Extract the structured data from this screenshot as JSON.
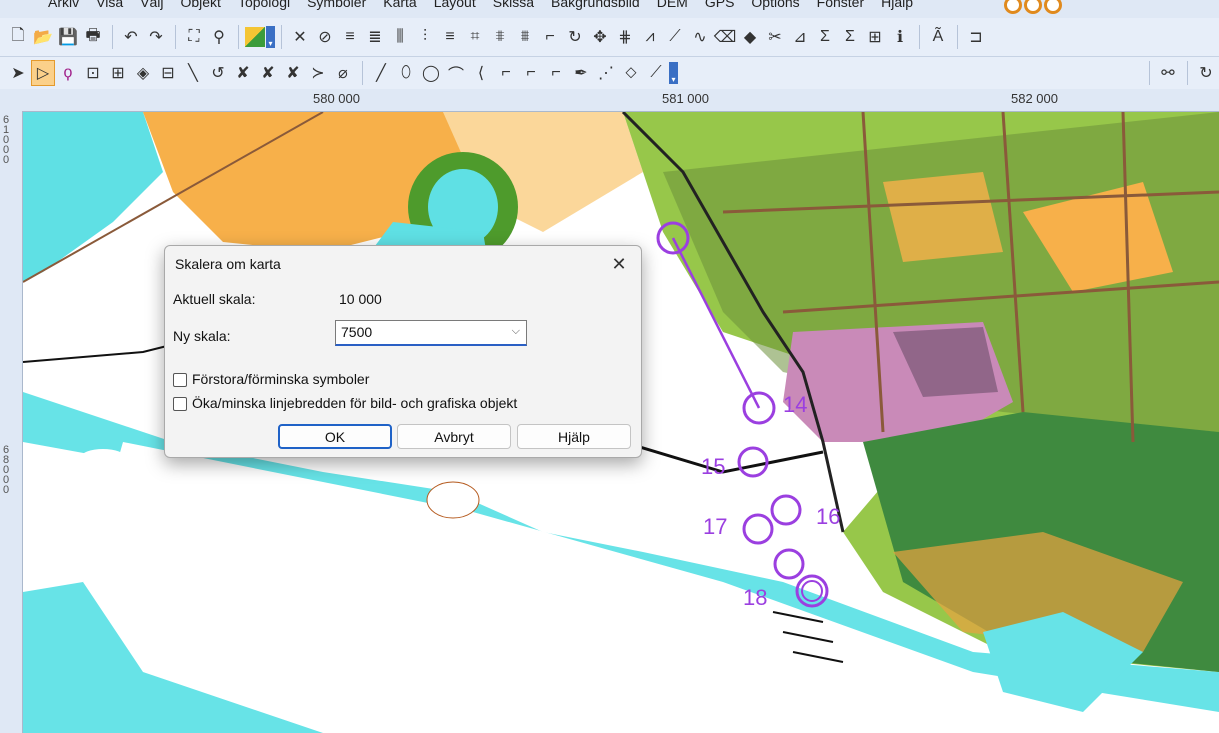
{
  "menu": {
    "items": [
      "Arkiv",
      "Visa",
      "Välj",
      "Objekt",
      "Topologi",
      "Symboler",
      "Karta",
      "Layout",
      "Skissa",
      "Bakgrundsbild",
      "DEM",
      "GPS",
      "Options",
      "Fönster",
      "Hjälp"
    ]
  },
  "ruler": {
    "top_ticks": [
      "580 000",
      "581 000",
      "582 000"
    ],
    "left_ticks": [
      "61000",
      "68000"
    ]
  },
  "map": {
    "controls": [
      "14",
      "15",
      "16",
      "17",
      "18"
    ]
  },
  "dialog": {
    "title": "Skalera om karta",
    "current_scale_label": "Aktuell skala:",
    "current_scale_value": "10 000",
    "new_scale_label": "Ny skala:",
    "new_scale_value": "7500",
    "option_symbols": "Förstora/förminska symboler",
    "option_linewidth": "Öka/minska linjebredden för bild- och grafiska objekt",
    "ok_label": "OK",
    "cancel_label": "Avbryt",
    "help_label": "Hjälp"
  }
}
